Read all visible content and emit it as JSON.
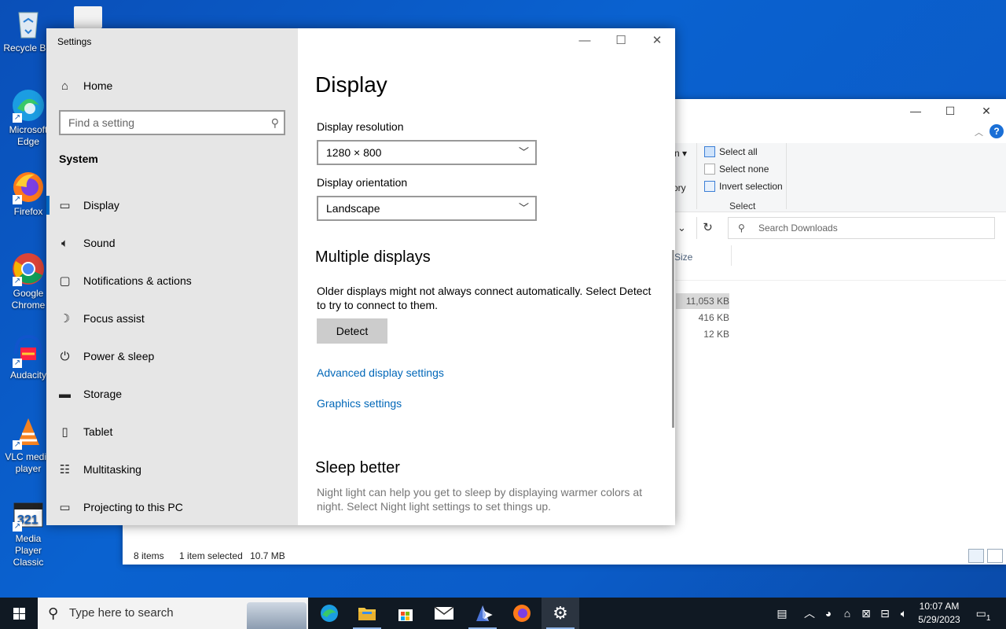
{
  "desktop": {
    "icons": [
      {
        "label": "Recycle Bin",
        "icon": "recycle-bin-icon"
      },
      {
        "label": "Microsoft Edge",
        "icon": "edge-icon"
      },
      {
        "label": "Firefox",
        "icon": "firefox-icon"
      },
      {
        "label": "Google Chrome",
        "icon": "chrome-icon"
      },
      {
        "label": "Audacity",
        "icon": "audacity-icon"
      },
      {
        "label": "VLC media player",
        "icon": "vlc-icon"
      },
      {
        "label": "Media Player Classic",
        "icon": "mpc-icon"
      }
    ]
  },
  "explorer": {
    "ribbon": {
      "select_all": "Select all",
      "select_none": "Select none",
      "invert_selection": "Invert selection",
      "group_label": "Select",
      "partial_left_top": "n",
      "partial_left_mid": "ory"
    },
    "search_placeholder": "Search Downloads",
    "column_size": "Size",
    "sizes": [
      "11,053 KB",
      "416 KB",
      "12 KB"
    ],
    "status_items": "8 items",
    "status_selected": "1 item selected",
    "status_size": "10.7 MB"
  },
  "settings": {
    "window_title": "Settings",
    "nav": {
      "home": "Home",
      "find_placeholder": "Find a setting",
      "section": "System",
      "items": [
        {
          "label": "Display",
          "icon": "monitor-icon"
        },
        {
          "label": "Sound",
          "icon": "speaker-icon"
        },
        {
          "label": "Notifications & actions",
          "icon": "notification-icon"
        },
        {
          "label": "Focus assist",
          "icon": "moon-icon"
        },
        {
          "label": "Power & sleep",
          "icon": "power-icon"
        },
        {
          "label": "Storage",
          "icon": "storage-icon"
        },
        {
          "label": "Tablet",
          "icon": "tablet-icon"
        },
        {
          "label": "Multitasking",
          "icon": "multitasking-icon"
        },
        {
          "label": "Projecting to this PC",
          "icon": "projecting-icon"
        }
      ]
    },
    "content": {
      "title": "Display",
      "resolution_label": "Display resolution",
      "resolution_value": "1280 × 800",
      "orientation_label": "Display orientation",
      "orientation_value": "Landscape",
      "multiple_heading": "Multiple displays",
      "multiple_text": "Older displays might not always connect automatically. Select Detect to try to connect to them.",
      "detect_button": "Detect",
      "advanced_link": "Advanced display settings",
      "graphics_link": "Graphics settings",
      "sleep_heading": "Sleep better",
      "sleep_text": "Night light can help you get to sleep by displaying warmer colors at night. Select Night light settings to set things up."
    }
  },
  "taskbar": {
    "search_placeholder": "Type here to search",
    "clock_time": "10:07 AM",
    "clock_date": "5/29/2023",
    "notification_count": "1"
  },
  "colors": {
    "accent": "#0067c0",
    "link": "#0067b8",
    "desktop": "#0a5cc8"
  }
}
